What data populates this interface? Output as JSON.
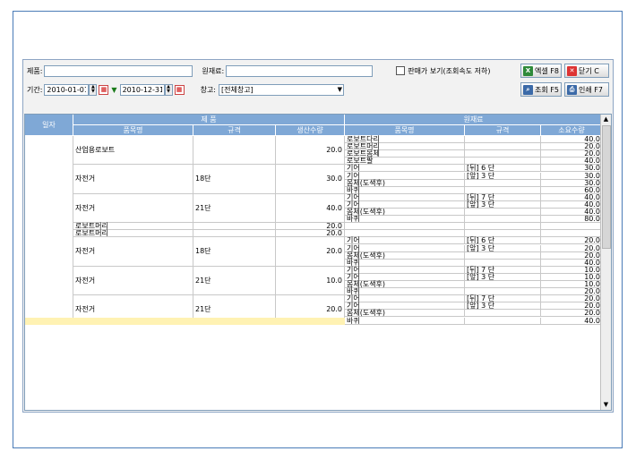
{
  "filters": {
    "product_label": "제품:",
    "product_value": "",
    "material_label": "원재료:",
    "material_value": "",
    "sales_view_label": "판매가 보기(조회속도 저하)",
    "period_label": "기간:",
    "date_from": "2010-01-01",
    "date_to": "2010-12-31",
    "warehouse_label": "창고:",
    "warehouse_value": "[전체창고]"
  },
  "buttons": {
    "excel": "엑셀 F8",
    "close": "닫기 C",
    "search": "조회 F5",
    "print": "인쇄 F7"
  },
  "columns": {
    "date": "일자",
    "product_group": "제 품",
    "material_group": "원재료",
    "product_name": "품목명",
    "spec": "규격",
    "production_qty": "생산수량",
    "material_name": "품목명",
    "material_spec": "규격",
    "required_qty": "소요수량"
  },
  "rows": [
    {
      "product": "산업용로보트",
      "spec": "",
      "qty": "20.0",
      "mats": [
        {
          "name": "로보트다리",
          "spec": "",
          "qty": "40.0"
        },
        {
          "name": "로보트머리",
          "spec": "",
          "qty": "20.0"
        },
        {
          "name": "로보트몸체",
          "spec": "",
          "qty": "20.0"
        },
        {
          "name": "로보트팔",
          "spec": "",
          "qty": "40.0"
        }
      ]
    },
    {
      "product": "자전거",
      "spec": "18단",
      "qty": "30.0",
      "mats": [
        {
          "name": "기어",
          "spec": "[뒤] 6 단",
          "qty": "30.0"
        },
        {
          "name": "기어",
          "spec": "[앞] 3 단",
          "qty": "30.0"
        },
        {
          "name": "몸체(도색후)",
          "spec": "",
          "qty": "30.0"
        },
        {
          "name": "바퀴",
          "spec": "",
          "qty": "60.0"
        }
      ]
    },
    {
      "product": "자전거",
      "spec": "21단",
      "qty": "40.0",
      "mats": [
        {
          "name": "기어",
          "spec": "[뒤] 7 단",
          "qty": "40.0"
        },
        {
          "name": "기어",
          "spec": "[앞] 3 단",
          "qty": "40.0"
        },
        {
          "name": "몸체(도색후)",
          "spec": "",
          "qty": "40.0"
        },
        {
          "name": "바퀴",
          "spec": "",
          "qty": "80.0"
        }
      ]
    },
    {
      "product": "로보트머리",
      "spec": "",
      "qty": "20.0",
      "mats": []
    },
    {
      "product": "로보트머리",
      "spec": "",
      "qty": "20.0",
      "mats": []
    },
    {
      "product": "자전거",
      "spec": "18단",
      "qty": "20.0",
      "mats": [
        {
          "name": "기어",
          "spec": "[뒤] 6 단",
          "qty": "20.0"
        },
        {
          "name": "기어",
          "spec": "[앞] 3 단",
          "qty": "20.0"
        },
        {
          "name": "몸체(도색후)",
          "spec": "",
          "qty": "20.0"
        },
        {
          "name": "바퀴",
          "spec": "",
          "qty": "40.0"
        }
      ]
    },
    {
      "product": "자전거",
      "spec": "21단",
      "qty": "10.0",
      "mats": [
        {
          "name": "기어",
          "spec": "[뒤] 7 단",
          "qty": "10.0"
        },
        {
          "name": "기어",
          "spec": "[앞] 3 단",
          "qty": "10.0"
        },
        {
          "name": "몸체(도색후)",
          "spec": "",
          "qty": "10.0"
        },
        {
          "name": "바퀴",
          "spec": "",
          "qty": "20.0"
        }
      ]
    },
    {
      "product": "자전거",
      "spec": "21단",
      "qty": "20.0",
      "mats": [
        {
          "name": "기어",
          "spec": "[뒤] 7 단",
          "qty": "20.0"
        },
        {
          "name": "기어",
          "spec": "[앞] 3 단",
          "qty": "20.0"
        },
        {
          "name": "몸체(도색후)",
          "spec": "",
          "qty": "20.0"
        },
        {
          "name": "바퀴",
          "spec": "",
          "qty": "40.0"
        }
      ]
    }
  ],
  "colors": {
    "header": "#7fa8d6",
    "frame": "#4a7bb7",
    "highlight": "#fff2b3"
  }
}
